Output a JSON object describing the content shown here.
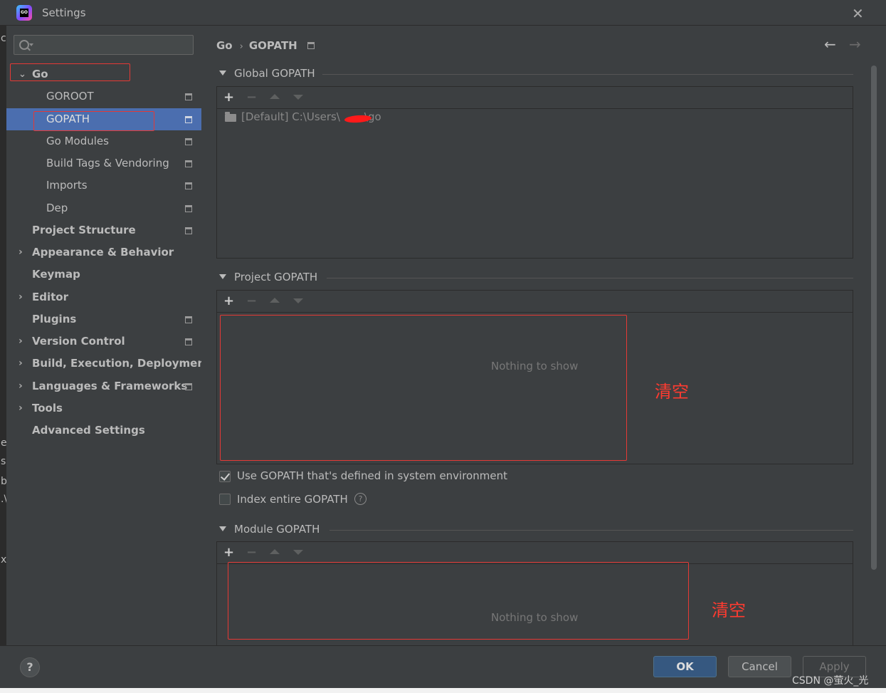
{
  "window": {
    "title": "Settings",
    "close_glyph": "✕",
    "icon": "goland-logo"
  },
  "search": {
    "placeholder": ""
  },
  "sidebar": {
    "items": [
      {
        "label": "Go",
        "arrow": "⌄"
      },
      {
        "label": "GOROOT"
      },
      {
        "label": "GOPATH"
      },
      {
        "label": "Go Modules"
      },
      {
        "label": "Build Tags & Vendoring"
      },
      {
        "label": "Imports"
      },
      {
        "label": "Dep"
      },
      {
        "label": "Project Structure"
      },
      {
        "label": "Appearance & Behavior",
        "arrow": "›"
      },
      {
        "label": "Keymap"
      },
      {
        "label": "Editor",
        "arrow": "›"
      },
      {
        "label": "Plugins"
      },
      {
        "label": "Version Control",
        "arrow": "›"
      },
      {
        "label": "Build, Execution, Deployment",
        "arrow": "›"
      },
      {
        "label": "Languages & Frameworks",
        "arrow": "›"
      },
      {
        "label": "Tools",
        "arrow": "›"
      },
      {
        "label": "Advanced Settings"
      }
    ]
  },
  "left_strip": [
    "c",
    "e",
    "s",
    "b",
    ".\\",
    "x"
  ],
  "breadcrumb": {
    "parent": "Go",
    "separator": "›",
    "current": "GOPATH",
    "back": "←",
    "forward": "→"
  },
  "toolbar": {
    "add": "+",
    "remove": "−"
  },
  "global_gopath": {
    "title": "Global GOPATH",
    "entry_prefix": "[Default] C:\\Users\\",
    "entry_suffix": "\\go"
  },
  "project_gopath": {
    "title": "Project GOPATH",
    "empty_text": "Nothing to show",
    "note": "清空"
  },
  "options": {
    "use_system_gopath": {
      "label": "Use GOPATH that's defined in system environment",
      "checked": true
    },
    "index_entire_gopath": {
      "label": "Index entire GOPATH",
      "checked": false,
      "help": "?"
    }
  },
  "module_gopath": {
    "title": "Module GOPATH",
    "empty_text": "Nothing to show",
    "note": "清空"
  },
  "buttons": {
    "help": "?",
    "ok": "OK",
    "cancel": "Cancel",
    "apply": "Apply"
  },
  "watermark": "CSDN @萤火_光",
  "colors": {
    "selection": "#4b6eaf",
    "annotation_red": "#e53935",
    "background": "#3c3f41"
  }
}
